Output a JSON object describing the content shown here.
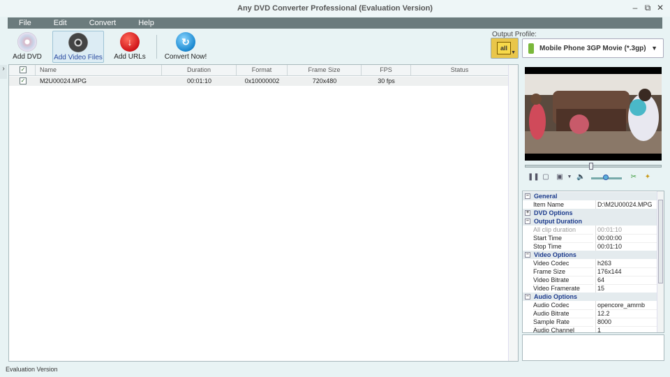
{
  "window": {
    "title": "Any DVD Converter Professional (Evaluation Version)"
  },
  "menu": [
    "File",
    "Edit",
    "Convert",
    "Help"
  ],
  "toolbar": {
    "add_dvd": "Add DVD",
    "add_video_files": "Add Video Files",
    "add_urls": "Add URLs",
    "convert_now": "Convert Now!"
  },
  "output_profile": {
    "label": "Output Profile:",
    "all_button": "all",
    "selected": "Mobile Phone 3GP Movie (*.3gp)"
  },
  "file_list": {
    "columns": [
      "Name",
      "Duration",
      "Format",
      "Frame Size",
      "FPS",
      "Status"
    ],
    "rows": [
      {
        "checked": true,
        "name": "M2U00024.MPG",
        "duration": "00:01:10",
        "format": "0x10000002",
        "frame_size": "720x480",
        "fps": "30 fps",
        "status": ""
      }
    ]
  },
  "properties": {
    "general": "General",
    "item_name_k": "Item Name",
    "item_name_v": "D:\\M2U00024.MPG",
    "dvd_options": "DVD Options",
    "output_duration": "Output Duration",
    "all_clip_k": "All clip duration",
    "all_clip_v": "00:01:10",
    "start_time_k": "Start Time",
    "start_time_v": "00:00:00",
    "stop_time_k": "Stop Time",
    "stop_time_v": "00:01:10",
    "video_options": "Video Options",
    "video_codec_k": "Video Codec",
    "video_codec_v": "h263",
    "frame_size_k": "Frame Size",
    "frame_size_v": "176x144",
    "video_bitrate_k": "Video Bitrate",
    "video_bitrate_v": "64",
    "video_framerate_k": "Video Framerate",
    "video_framerate_v": "15",
    "audio_options": "Audio Options",
    "audio_codec_k": "Audio Codec",
    "audio_codec_v": "opencore_amrnb",
    "audio_bitrate_k": "Audio Bitrate",
    "audio_bitrate_v": "12.2",
    "sample_rate_k": "Sample Rate",
    "sample_rate_v": "8000",
    "audio_channel_k": "Audio Channel",
    "audio_channel_v": "1"
  },
  "status": {
    "text": "Evaluation Version"
  },
  "icons": {
    "add_dvd": "disc-icon",
    "add_video_files": "film-reel-icon",
    "add_urls": "download-icon",
    "convert_now": "convert-icon"
  },
  "colors": {
    "accent": "#2a4aa0",
    "menubar": "#6b7b7d",
    "group_text": "#1b3a8c"
  }
}
